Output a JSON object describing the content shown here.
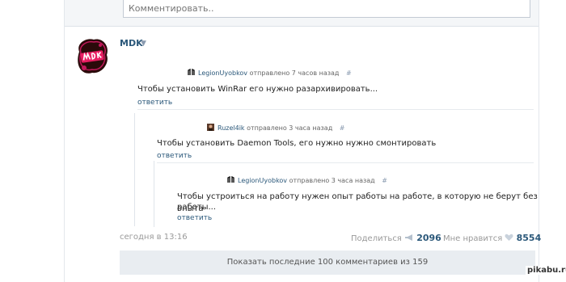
{
  "comment_box": {
    "placeholder": "Комментировать.."
  },
  "post": {
    "author": "MDK",
    "posted_time": "сегодня в 13:16",
    "share_label": "Поделиться",
    "share_count": "2096",
    "like_label": "Мне нравится",
    "like_count": "8554"
  },
  "thread": [
    {
      "username": "LegionUyobkov",
      "sent": "отправлено 7 часов назад",
      "hash": "#",
      "lines": [
        "Чтобы установить WinRar его нужно разархивировать..."
      ],
      "reply": "ответить"
    },
    {
      "username": "Ruzel4ik",
      "sent": "отправлено 3 часа назад",
      "hash": "#",
      "lines": [
        "Чтобы установить Daemon Tools, его нужно нужно смонтировать"
      ],
      "reply": "ответить"
    },
    {
      "username": "LegionUyobkov",
      "sent": "отправлено 3 часа назад",
      "hash": "#",
      "lines": [
        "Чтобы устроиться на работу нужен опыт работы на работе, в которую не берут без опыта",
        "работы..."
      ],
      "reply": "ответить"
    }
  ],
  "show_more": "Показать последние 100 комментариев из 159",
  "watermark": "pikabu.ru",
  "icons": {
    "avatar": "mdk-logo-avatar",
    "share": "megaphone-icon",
    "like": "heart-icon",
    "caret": "chevron-down-icon"
  }
}
